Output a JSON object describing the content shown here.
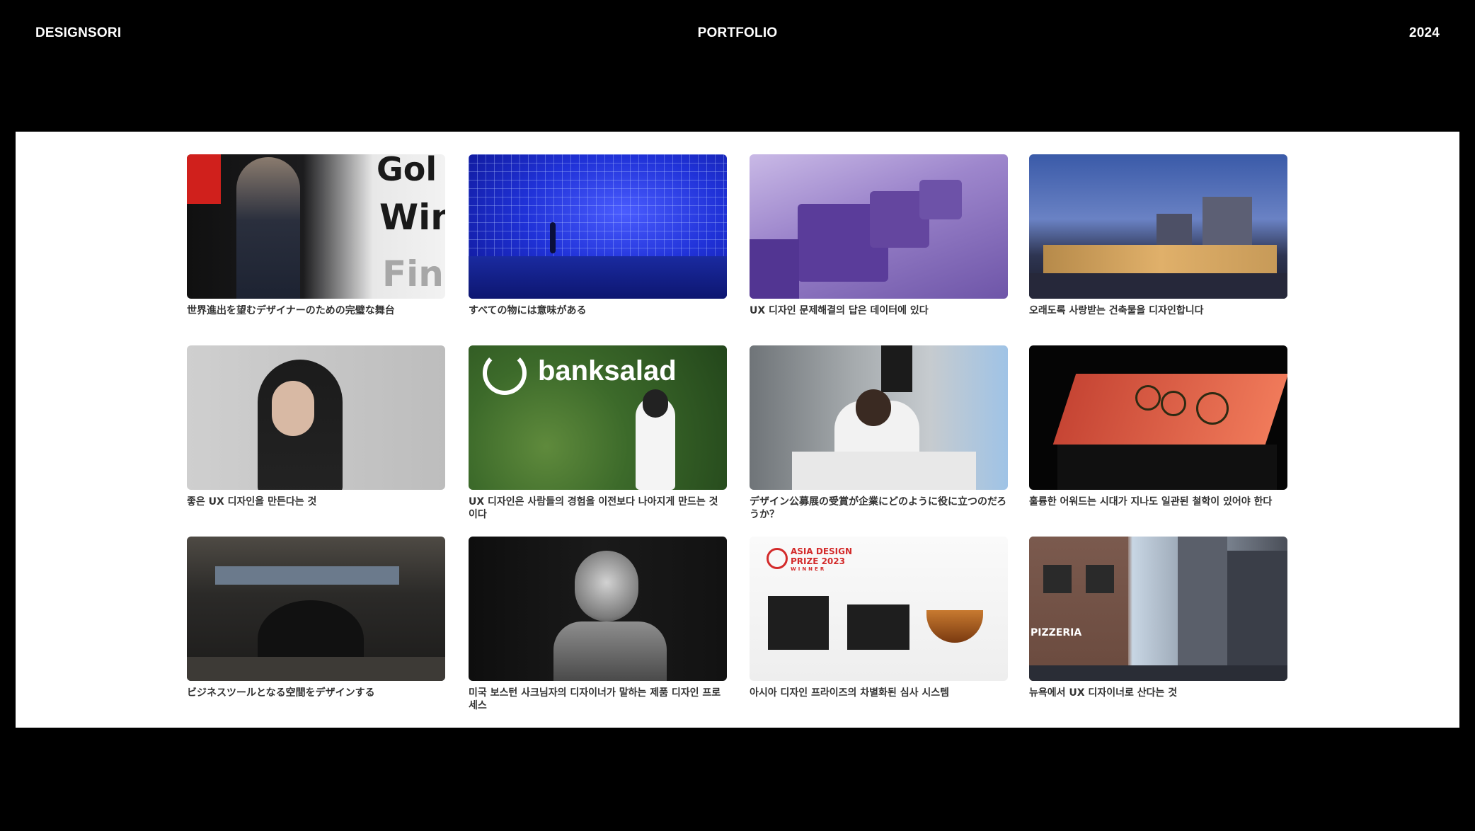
{
  "header": {
    "brand": "DESIGNSORI",
    "title": "PORTFOLIO",
    "year": "2024"
  },
  "cards": [
    {
      "caption": "世界進出を望むデザイナーのための完璧な舞台",
      "thumb_text": [
        "Gol",
        "Win",
        "Fina"
      ]
    },
    {
      "caption": "すべての物には意味がある"
    },
    {
      "caption": "UX 디자인 문제해결의 답은 데이터에 있다"
    },
    {
      "caption": "오래도록 사랑받는 건축물을 디자인합니다"
    },
    {
      "caption": "좋은 UX 디자인을 만든다는 것"
    },
    {
      "caption": "UX 디자인은 사람들의 경험을 이전보다 나아지게 만드는 것이다",
      "thumb_text": "banksalad"
    },
    {
      "caption": "デザイン公募展の受賞が企業にどのように役に立つのだろうか？"
    },
    {
      "caption": "훌륭한 어워드는 시대가 지나도 일관된 철학이 있어야 한다"
    },
    {
      "caption": "ビジネスツールとなる空間をデザインする"
    },
    {
      "caption": "미국 보스턴 사크님자의 디자이너가 말하는 제품 디자인 프로세스"
    },
    {
      "caption": "아시아 디자인 프라이즈의 차별화된 심사 시스템",
      "thumb_text": [
        "ASIA DESIGN",
        "PRIZE 2023",
        "WINNER"
      ]
    },
    {
      "caption": "뉴욕에서 UX 디자이너로 산다는 것",
      "thumb_text": "PIZZERIA"
    }
  ]
}
